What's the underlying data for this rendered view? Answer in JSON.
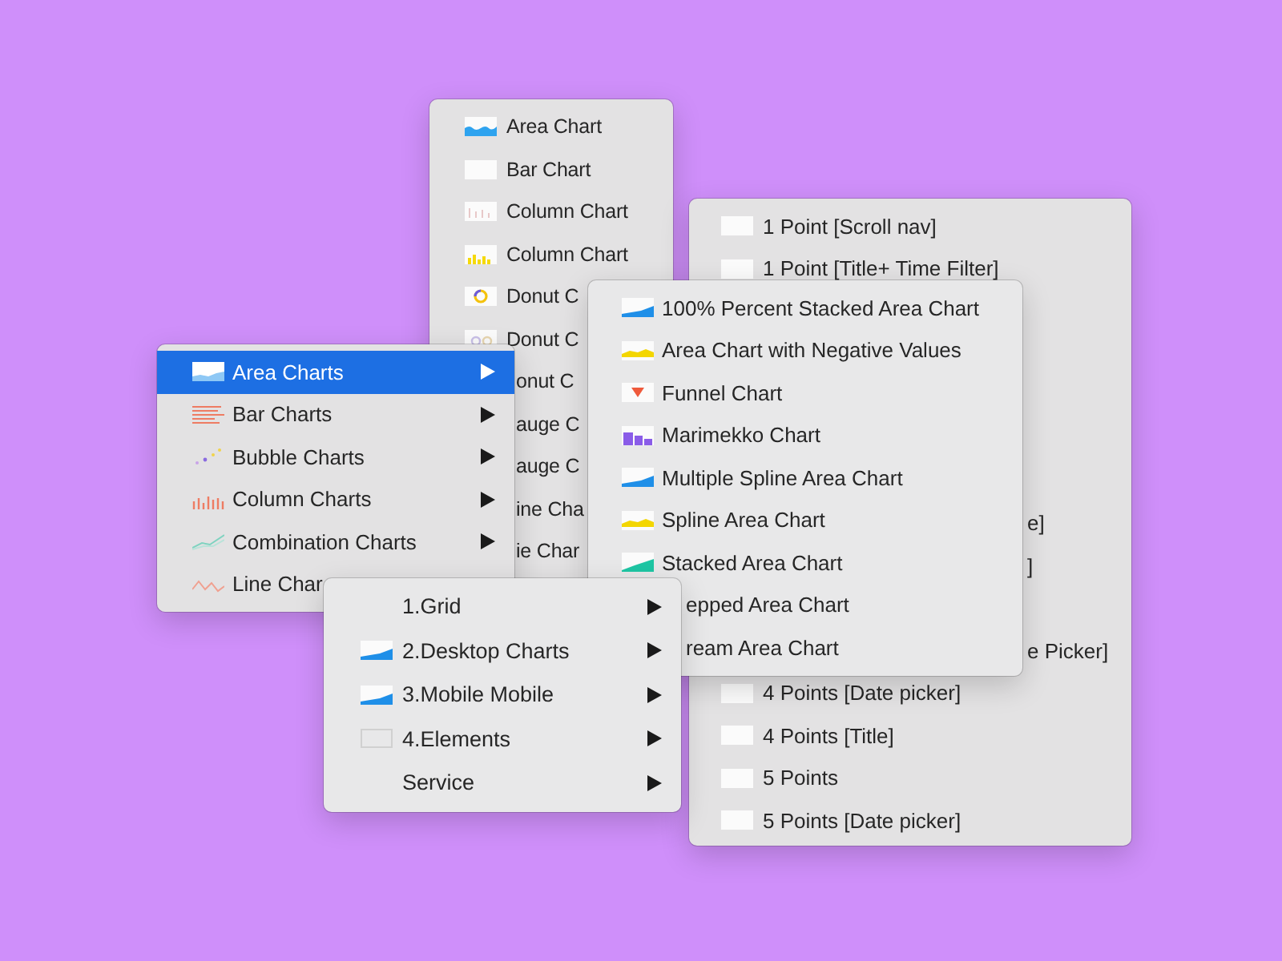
{
  "chart_list_menu": {
    "items": [
      {
        "label": "Area Chart",
        "kind": "item"
      },
      {
        "label": "Bar Chart",
        "kind": "item"
      },
      {
        "label": "Column Chart",
        "kind": "item"
      },
      {
        "label": "Column Chart",
        "kind": "item"
      },
      {
        "label": "Donut C",
        "kind": "item"
      },
      {
        "label": "Donut C",
        "kind": "item"
      },
      {
        "label": "onut C",
        "kind": "fragment"
      },
      {
        "label": "auge C",
        "kind": "fragment"
      },
      {
        "label": "auge C",
        "kind": "fragment"
      },
      {
        "label": "ine Cha",
        "kind": "fragment"
      },
      {
        "label": "ie Char",
        "kind": "fragment"
      }
    ]
  },
  "points_menu": {
    "items": [
      {
        "label": "1 Point [Scroll nav]",
        "kind": "item"
      },
      {
        "label": "1 Point [Title+ Time Filter]",
        "kind": "item"
      },
      {
        "kind": "covered"
      },
      {
        "kind": "covered"
      },
      {
        "kind": "covered"
      },
      {
        "kind": "covered"
      },
      {
        "kind": "covered"
      },
      {
        "label": "e]",
        "kind": "fragment"
      },
      {
        "label": "]",
        "kind": "fragment"
      },
      {
        "kind": "covered"
      },
      {
        "label": "e Picker]",
        "kind": "fragment"
      },
      {
        "label": "4 Points [Date picker]",
        "kind": "item"
      },
      {
        "label": "4 Points [Title]",
        "kind": "item"
      },
      {
        "label": "5 Points",
        "kind": "item"
      },
      {
        "label": "5 Points [Date picker]",
        "kind": "item"
      }
    ]
  },
  "area_charts_submenu": {
    "items": [
      {
        "label": "100% Percent Stacked Area Chart",
        "kind": "item"
      },
      {
        "label": "Area Chart with Negative Values",
        "kind": "item"
      },
      {
        "label": "Funnel Chart",
        "kind": "item"
      },
      {
        "label": "Marimekko Chart",
        "kind": "item"
      },
      {
        "label": "Multiple Spline Area Chart",
        "kind": "item"
      },
      {
        "label": "Spline Area Chart",
        "kind": "item"
      },
      {
        "label": "Stacked Area Chart",
        "kind": "item"
      },
      {
        "label": "epped Area Chart",
        "kind": "fragment"
      },
      {
        "label": "ream Area Chart",
        "kind": "fragment"
      }
    ]
  },
  "categories_menu": {
    "items": [
      {
        "label": "Area Charts",
        "kind": "item",
        "selected": true
      },
      {
        "label": "Bar Charts",
        "kind": "item",
        "selected": false
      },
      {
        "label": "Bubble Charts",
        "kind": "item",
        "selected": false
      },
      {
        "label": "Column Charts",
        "kind": "item",
        "selected": false
      },
      {
        "label": "Combination Charts",
        "kind": "item",
        "selected": false
      },
      {
        "label": "Line Char",
        "kind": "fragment",
        "selected": false
      }
    ]
  },
  "sections_menu": {
    "items": [
      {
        "label": "1.Grid",
        "kind": "item"
      },
      {
        "label": "2.Desktop Charts",
        "kind": "item"
      },
      {
        "label": "3.Mobile Mobile",
        "kind": "item"
      },
      {
        "label": "4.Elements",
        "kind": "item"
      },
      {
        "label": "Service",
        "kind": "item"
      }
    ]
  }
}
